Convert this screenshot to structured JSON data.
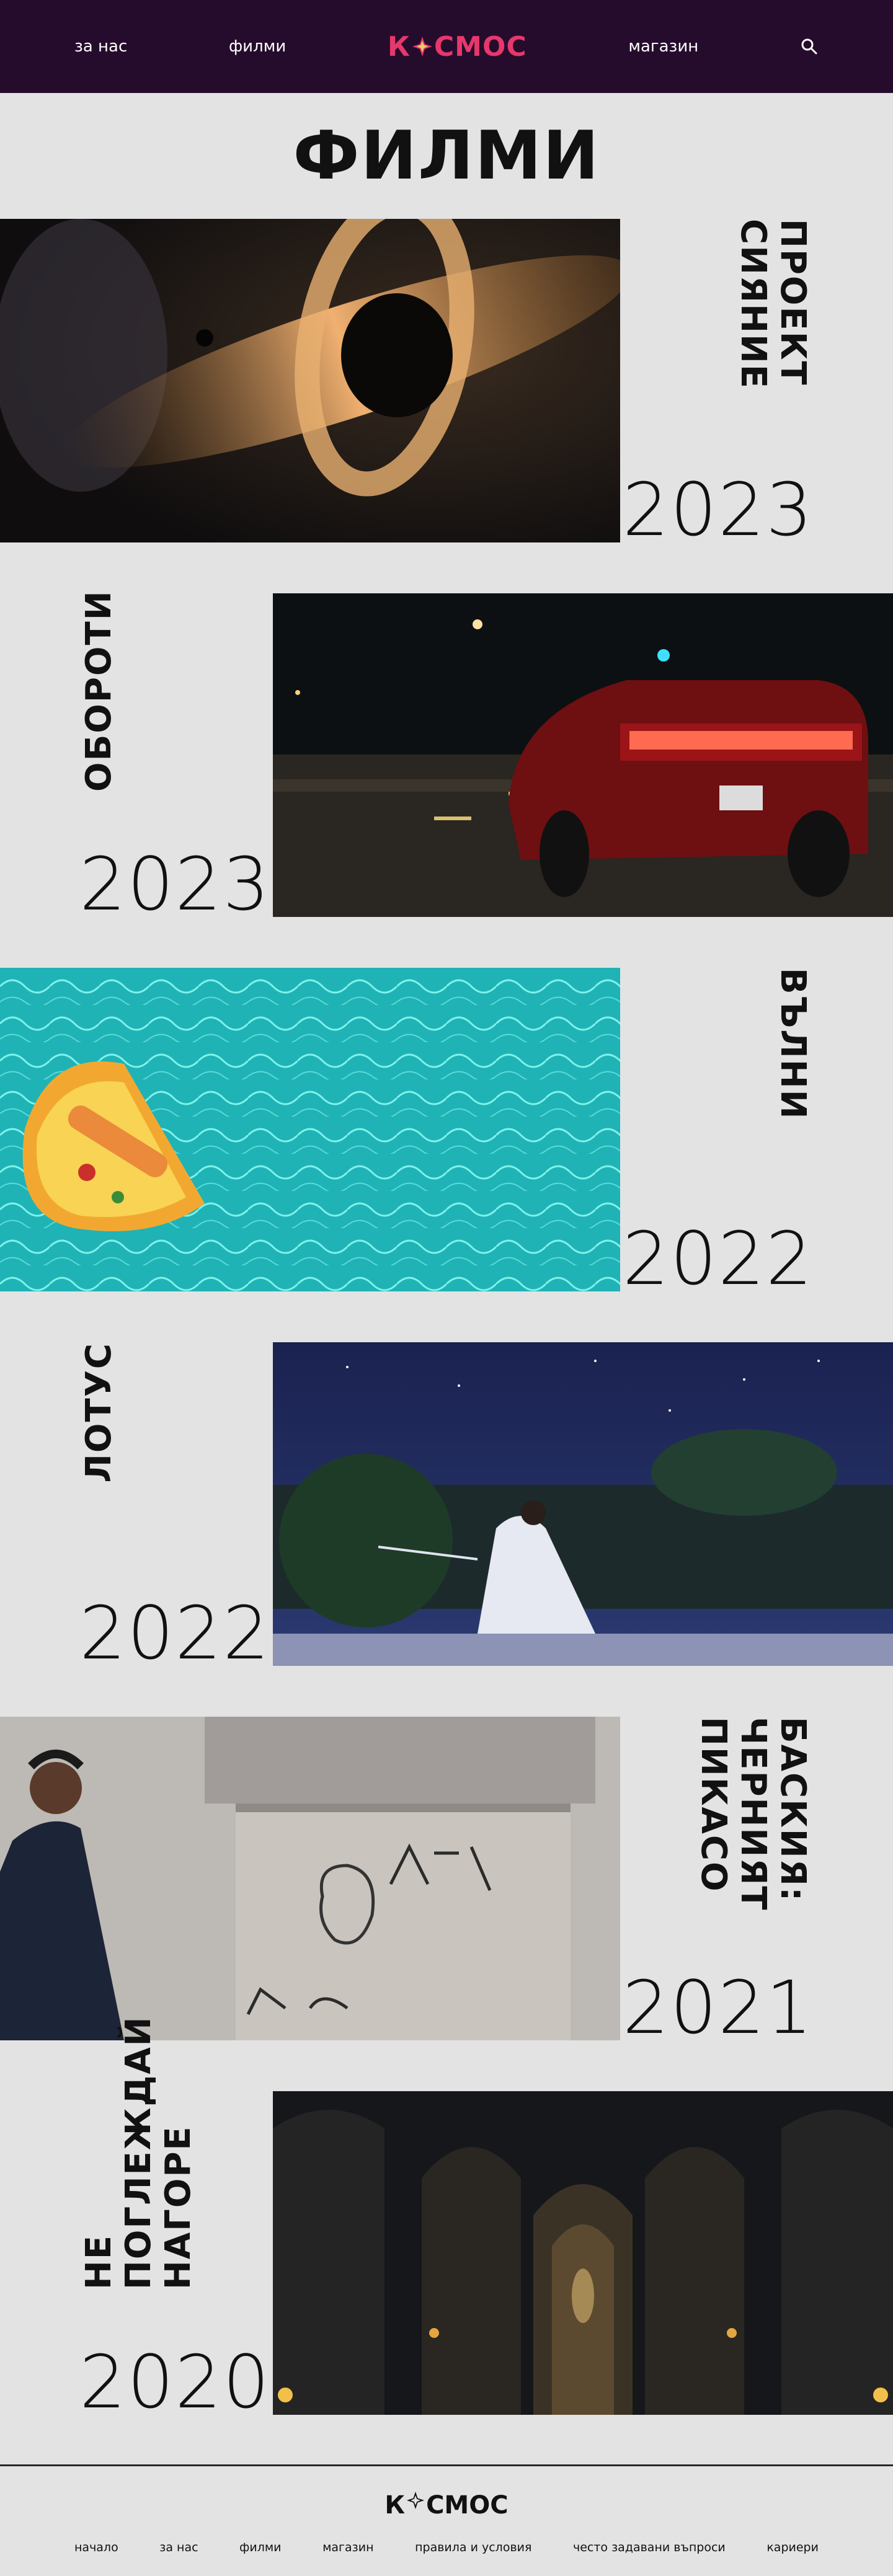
{
  "header": {
    "nav_left": [
      "за нас",
      "филми"
    ],
    "logo_left": "К",
    "logo_right": "СМОС",
    "nav_right": [
      "магазин"
    ],
    "search_icon": "search-icon",
    "logo_color": "#e6386c",
    "bg_color": "#260c2c"
  },
  "page": {
    "title": "ФИЛМИ"
  },
  "films": [
    {
      "title": "ПРОЕКТ СИЯНИЕ",
      "year": "2023"
    },
    {
      "title": "ОБОРОТИ",
      "year": "2023"
    },
    {
      "title": "ВЪЛНИ",
      "year": "2022"
    },
    {
      "title": "ЛОТУС",
      "year": "2022"
    },
    {
      "title": "БАСКИЯ: ЧЕРНИЯТ ПИКАСО",
      "year": "2021"
    },
    {
      "title": "НЕ ПОГЛЕЖДАЙ НАГОРЕ",
      "year": "2020"
    }
  ],
  "footer": {
    "logo_left": "К",
    "logo_right": "СМОС",
    "links": [
      "начало",
      "за нас",
      "филми",
      "магазин",
      "правила и условия",
      "често задавани въпроси",
      "кариери"
    ]
  }
}
